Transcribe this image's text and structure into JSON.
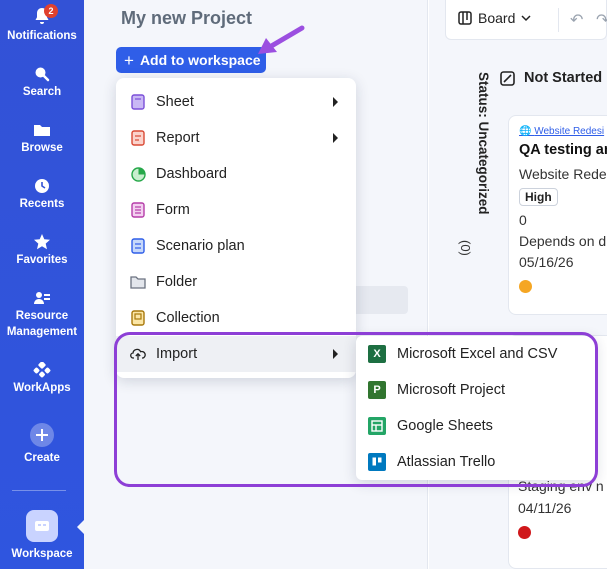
{
  "rail": {
    "notifications": {
      "label": "Notifications",
      "badge": "2"
    },
    "search": {
      "label": "Search"
    },
    "browse": {
      "label": "Browse"
    },
    "recents": {
      "label": "Recents"
    },
    "favorites": {
      "label": "Favorites"
    },
    "resource_line1": "Resource",
    "resource_line2": "Management",
    "workapps": {
      "label": "WorkApps"
    },
    "create": {
      "label": "Create"
    },
    "workspace": {
      "label": "Workspace"
    }
  },
  "project": {
    "title": "My new Project",
    "add_button": "Add to workspace"
  },
  "menu": {
    "items": [
      {
        "label": "Sheet",
        "icon": "sheet-icon",
        "has_submenu": true
      },
      {
        "label": "Report",
        "icon": "report-icon",
        "has_submenu": true
      },
      {
        "label": "Dashboard",
        "icon": "dashboard-icon",
        "has_submenu": false
      },
      {
        "label": "Form",
        "icon": "form-icon",
        "has_submenu": false
      },
      {
        "label": "Scenario plan",
        "icon": "scenario-plan-icon",
        "has_submenu": false
      },
      {
        "label": "Folder",
        "icon": "folder-icon",
        "has_submenu": false
      },
      {
        "label": "Collection",
        "icon": "collection-icon",
        "has_submenu": false
      },
      {
        "label": "Import",
        "icon": "import-icon",
        "has_submenu": true
      }
    ]
  },
  "import_submenu": {
    "items": [
      {
        "label": "Microsoft Excel and CSV",
        "icon": "excel-icon",
        "glyph": "X",
        "color": "#1d6f42"
      },
      {
        "label": "Microsoft Project",
        "icon": "ms-project-icon",
        "glyph": "P",
        "color": "#31752f"
      },
      {
        "label": "Google Sheets",
        "icon": "google-sheets-icon",
        "glyph": "",
        "color": "#23a566"
      },
      {
        "label": "Atlassian Trello",
        "icon": "trello-icon",
        "glyph": "",
        "color": "#0079bf"
      }
    ]
  },
  "board": {
    "view_label": "Board",
    "status_group": "Status: Uncategorized",
    "status_count": "(0)",
    "column_header": "Not Started",
    "card1": {
      "project": "Website Redesi",
      "title": "QA testing an",
      "subtitle": "Website Rede",
      "priority": "High",
      "count": "0",
      "depends": "Depends on d",
      "date": "05/16/26",
      "dot_color": "#f5a623"
    },
    "card2": {
      "env": "Staging env n",
      "date": "04/11/26",
      "dot_color": "#d0181b"
    }
  },
  "colors": {
    "rail": "#2f55df",
    "accent": "#2f5ee8",
    "highlight": "#8d3fd6"
  }
}
